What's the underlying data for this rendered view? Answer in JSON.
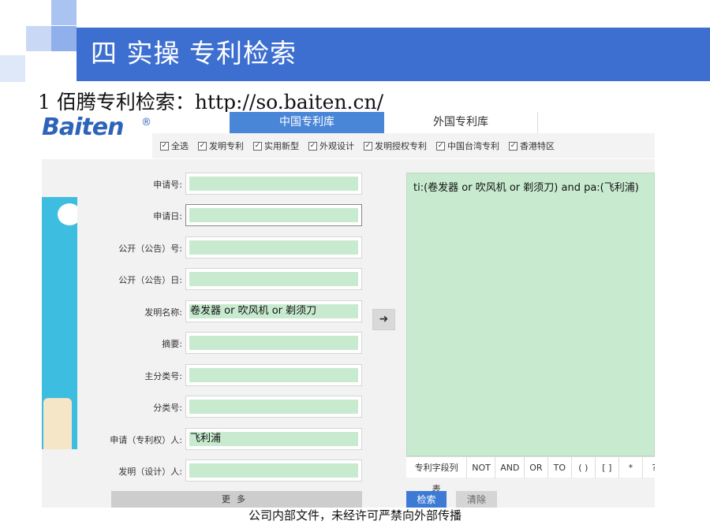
{
  "slide": {
    "title": "四 实操  专利检索",
    "subtitle": "1 佰腾专利检索：http://so.baiten.cn/",
    "footer": "公司内部文件，未经许可严禁向外部传播"
  },
  "app": {
    "logo_text": "Baiten",
    "logo_mark": "®",
    "tabs": [
      {
        "label": "中国专利库",
        "active": true
      },
      {
        "label": "外国专利库",
        "active": false
      }
    ],
    "filters": [
      {
        "label": "全选",
        "checked": true
      },
      {
        "label": "发明专利",
        "checked": true
      },
      {
        "label": "实用新型",
        "checked": true
      },
      {
        "label": "外观设计",
        "checked": true
      },
      {
        "label": "发明授权专利",
        "checked": true
      },
      {
        "label": "中国台湾专利",
        "checked": true
      },
      {
        "label": "香港特区",
        "checked": true
      }
    ],
    "fields": [
      {
        "label": "申请号:",
        "value": ""
      },
      {
        "label": "申请日:",
        "value": ""
      },
      {
        "label": "公开（公告）号:",
        "value": ""
      },
      {
        "label": "公开（公告）日:",
        "value": ""
      },
      {
        "label": "发明名称:",
        "value": "卷发器 or 吹风机 or 剃须刀"
      },
      {
        "label": "摘要:",
        "value": ""
      },
      {
        "label": "主分类号:",
        "value": ""
      },
      {
        "label": "分类号:",
        "value": ""
      },
      {
        "label": "申请（专利权）人:",
        "value": "飞利浦"
      },
      {
        "label": "发明（设计）人:",
        "value": ""
      }
    ],
    "arrow_symbol": "➜",
    "query": "ti:(卷发器 or 吹风机 or 剃须刀) and pa:(飞利浦)",
    "operators": [
      "专利字段列表",
      "NOT",
      "AND",
      "OR",
      "TO",
      "( )",
      "[ ]",
      "*",
      "?"
    ],
    "more_label": "更多",
    "search_label": "检索",
    "clear_label": "清除",
    "colors": {
      "title_bar": "#3d6fd1",
      "active_tab": "#4a86d8",
      "field_fill": "#c8ebd0",
      "search_button": "#3d7ad5"
    }
  }
}
